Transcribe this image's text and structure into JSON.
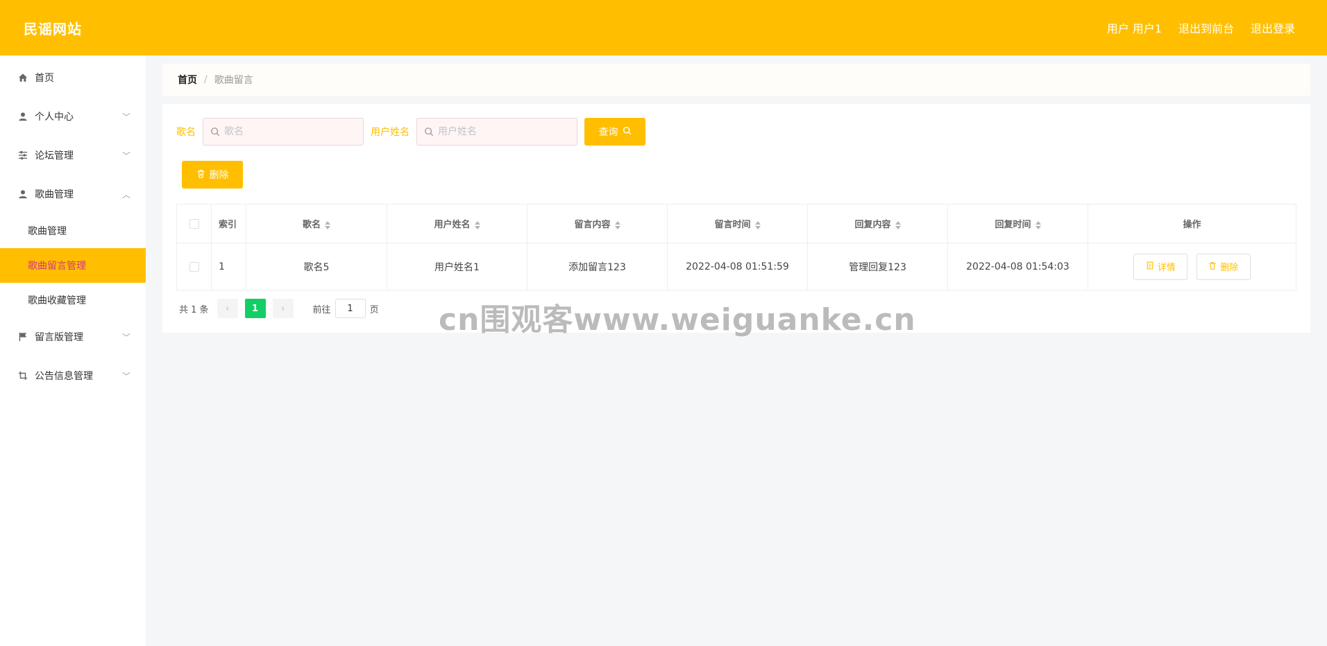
{
  "header": {
    "brand": "民谣网站",
    "user_label": "用户 用户1",
    "to_front_label": "退出到前台",
    "logout_label": "退出登录"
  },
  "sidebar": {
    "home": "首页",
    "profile": "个人中心",
    "forum": "论坛管理",
    "songs": "歌曲管理",
    "sub_songs": "歌曲管理",
    "sub_comments": "歌曲留言管理",
    "sub_favorites": "歌曲收藏管理",
    "guestbook": "留言版管理",
    "notices": "公告信息管理"
  },
  "breadcrumb": {
    "home": "首页",
    "sep": "/",
    "current": "歌曲留言"
  },
  "search": {
    "song_label": "歌名",
    "song_placeholder": "歌名",
    "user_label": "用户姓名",
    "user_placeholder": "用户姓名",
    "query_label": "查询"
  },
  "toolbar": {
    "delete_label": "删除"
  },
  "table": {
    "headers": {
      "index": "索引",
      "song": "歌名",
      "user": "用户姓名",
      "content": "留言内容",
      "time": "留言时间",
      "reply": "回复内容",
      "reply_time": "回复时间",
      "actions": "操作"
    },
    "rows": [
      {
        "index": "1",
        "song": "歌名5",
        "user": "用户姓名1",
        "content": "添加留言123",
        "time": "2022-04-08 01:51:59",
        "reply": "管理回复123",
        "reply_time": "2022-04-08 01:54:03",
        "detail_label": "详情",
        "delete_label": "删除"
      }
    ]
  },
  "pagination": {
    "total": "共 1 条",
    "current_page": "1",
    "goto_prefix": "前往",
    "goto_value": "1",
    "goto_suffix": "页"
  },
  "watermark": "cn围观客www.weiguanke.cn",
  "colors": {
    "accent": "#ffbf00",
    "active_page": "#13ce66",
    "active_menu_text": "#d63384"
  }
}
